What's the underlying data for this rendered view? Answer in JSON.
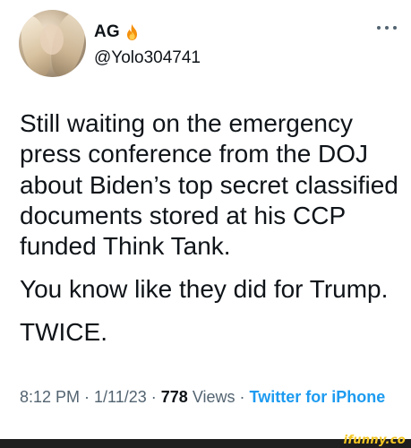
{
  "tweet": {
    "display_name": "AG",
    "handle": "@Yolo304741",
    "paragraphs": [
      "Still waiting on the emergency press conference from the DOJ about Biden’s top secret classified documents stored at his CCP funded Think Tank.",
      "You know like they did for Trump.",
      "TWICE."
    ],
    "time": "8:12 PM",
    "date": "1/11/23",
    "views_count": "778",
    "views_label": "Views",
    "separator": " · ",
    "source": "Twitter for iPhone"
  },
  "icons": {
    "name_emoji": "fire-icon",
    "menu": "more-icon"
  },
  "watermark": "ifunny.co",
  "colors": {
    "text": "#0f1419",
    "secondary": "#536471",
    "link": "#1d9bf0",
    "watermark": "#f3c623",
    "footer": "#1f1f1f"
  }
}
